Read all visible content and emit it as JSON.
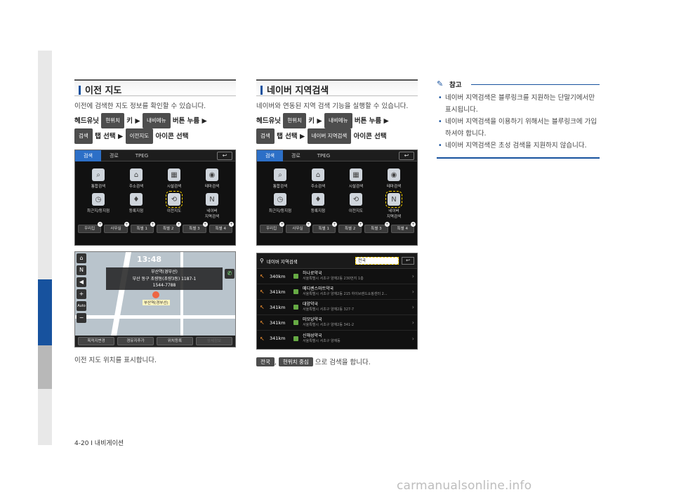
{
  "left": {
    "title": "이전 지도",
    "desc": "이전에 검색한 지도 정보를 확인할 수 있습니다.",
    "step1": {
      "a": "헤드유닛",
      "pill1": "현위치",
      "b": "키 ▶",
      "pill2": "내비메뉴",
      "c": "버튼 누름 ▶"
    },
    "step2": {
      "pill1": "검색",
      "a": "탭 선택 ▶",
      "pill2": "이전지도",
      "b": "아이콘 선택"
    },
    "menu": {
      "tabs": [
        "검색",
        "경로",
        "TPEG"
      ],
      "back": "↩",
      "items": [
        {
          "label": "통합검색",
          "icon": "search-icon"
        },
        {
          "label": "주소검색",
          "icon": "home-icon"
        },
        {
          "label": "시설검색",
          "icon": "facility-icon"
        },
        {
          "label": "테마검색",
          "icon": "camera-icon"
        },
        {
          "label": "최근지/등지점",
          "icon": "recent-icon"
        },
        {
          "label": "등록지점",
          "icon": "pin-icon"
        },
        {
          "label": "이전지도",
          "icon": "history-icon",
          "highlight": true
        },
        {
          "label": "네이버\n지역검색",
          "icon": "naver-icon"
        }
      ],
      "favs": [
        "우리집",
        "사무실",
        "특별 1",
        "특별 2",
        "특별 3",
        "특별 4"
      ]
    },
    "map": {
      "time": "13:48",
      "info1": "부산역(경부선)",
      "info2": "부산 동구 초량동(초량3동) 1187-1",
      "info3": "1544-7788",
      "poi": "부산역(경부선)",
      "bottom": [
        "목적지변경",
        "경유지추가",
        "위치등록",
        "상세정보"
      ],
      "zoom_mode": "Auto"
    },
    "caption": "이전 지도 위치를 표시합니다."
  },
  "mid": {
    "title": "네이버 지역검색",
    "desc": "네이버와 연동된 지역 검색 기능을 실행할 수 있습니다.",
    "step1": {
      "a": "헤드유닛",
      "pill1": "현위치",
      "b": "키 ▶",
      "pill2": "내비메뉴",
      "c": "버튼 누름 ▶"
    },
    "step2": {
      "pill1": "검색",
      "a": "탭 선택 ▶",
      "pill2": "네이버 지역검색",
      "b": "아이콘 선택"
    },
    "menu": {
      "tabs": [
        "검색",
        "경로",
        "TPEG"
      ],
      "back": "↩",
      "items": [
        {
          "label": "통합검색",
          "icon": "search-icon"
        },
        {
          "label": "주소검색",
          "icon": "home-icon"
        },
        {
          "label": "시설검색",
          "icon": "facility-icon"
        },
        {
          "label": "테마검색",
          "icon": "camera-icon"
        },
        {
          "label": "최근지/등지점",
          "icon": "recent-icon"
        },
        {
          "label": "등록지점",
          "icon": "pin-icon"
        },
        {
          "label": "이전지도",
          "icon": "history-icon"
        },
        {
          "label": "네이버\n지역검색",
          "icon": "naver-icon",
          "highlight": true
        }
      ],
      "favs": [
        "우리집",
        "사무실",
        "특별 1",
        "특별 2",
        "특별 3",
        "특별 4"
      ]
    },
    "list": {
      "title": "네이버 지역검색",
      "dropdown": "전국",
      "back": "↩",
      "rows": [
        {
          "dist": "340km",
          "name": "하나로약국",
          "addr": "서울특별시 서초구 양재2동 230번지 1층"
        },
        {
          "dist": "341km",
          "name": "메디쎈스마트약국",
          "addr": "서울특별시 서초구 양재2동 215 하이브랜드쇼핑센터 2..."
        },
        {
          "dist": "341km",
          "name": "대양약국",
          "addr": "서울특별시 서초구 양재2동 327-7"
        },
        {
          "dist": "341km",
          "name": "미모당약국",
          "addr": "서울특별시 서초구 양재2동 341-2"
        },
        {
          "dist": "341km",
          "name": "신해성약국",
          "addr": "서울특별시 서초구 양재동"
        }
      ]
    },
    "caption": {
      "pill1": "전국",
      "sep": ",",
      "pill2": "현위치 중심",
      "text": "으로 검색을 합니다."
    }
  },
  "note": {
    "title": "참고",
    "items": [
      "네이버 지역검색은 블루링크를 지원하는 단말기에서만 표시됩니다.",
      "네이버 지역검색을 이용하기 위해서는 블루링크에 가입하셔야 합니다.",
      "네이버 지역검색은 초성 검색을 지원하지 않습니다."
    ]
  },
  "footer": "4-20 I 내비게이션",
  "watermark": "carmanualsonline.info",
  "colors": {
    "accent": "#17529e",
    "sidebar": "#e8e8e8",
    "highlight": "#ffd400"
  }
}
